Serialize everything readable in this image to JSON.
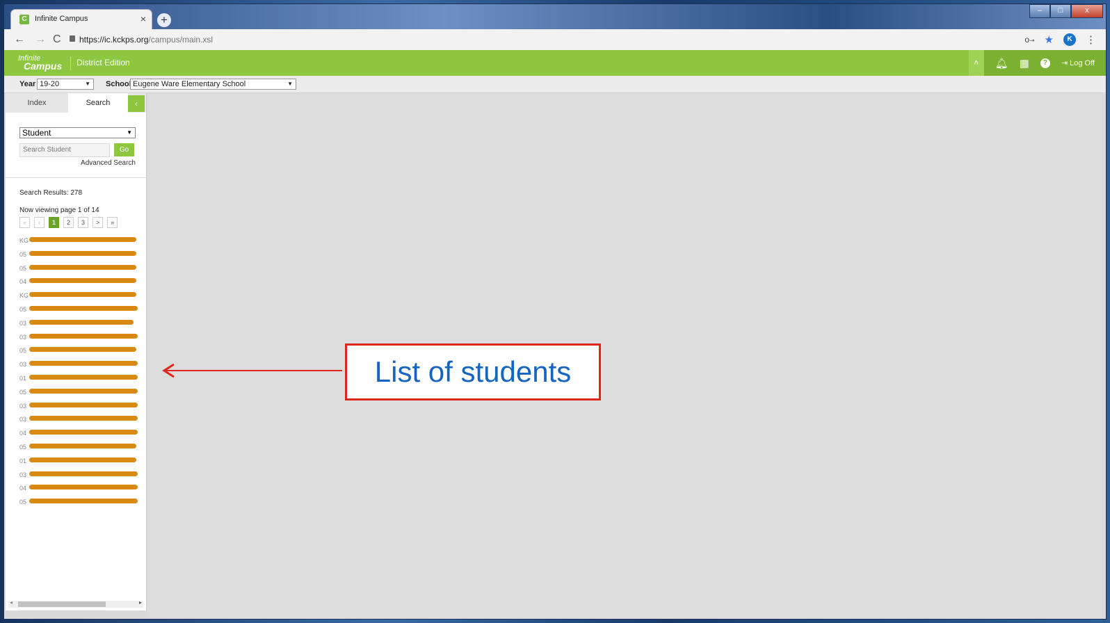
{
  "browser": {
    "tab_title": "Infinite Campus",
    "tab_close": "×",
    "new_tab": "+",
    "url_host": "https://ic.kckps.org",
    "url_path": "/campus/main.xsl",
    "avatar_letter": "K"
  },
  "app": {
    "logo_line1": "Infinite",
    "logo_line2": "Campus",
    "edition": "District Edition",
    "logoff_label": "Log Off",
    "accent_color": "#8dc63f"
  },
  "context": {
    "year_label": "Year",
    "year_value": "19-20",
    "school_label": "School",
    "school_value": "Eugene Ware Elementary School"
  },
  "panel": {
    "tabs": [
      "Index",
      "Search"
    ],
    "search_type": "Student",
    "search_placeholder": "Search Student",
    "go_label": "Go",
    "advanced_search": "Advanced Search",
    "results_text": "Search Results: 278",
    "viewing_text": "Now viewing page 1 of 14",
    "pager": [
      "«",
      "‹",
      "1",
      "2",
      "3",
      ">",
      "»"
    ],
    "students": [
      {
        "grade": "KG"
      },
      {
        "grade": "05"
      },
      {
        "grade": "05"
      },
      {
        "grade": "04"
      },
      {
        "grade": "KG"
      },
      {
        "grade": "05"
      },
      {
        "grade": "03"
      },
      {
        "grade": "03"
      },
      {
        "grade": "05"
      },
      {
        "grade": "03"
      },
      {
        "grade": "01"
      },
      {
        "grade": "05"
      },
      {
        "grade": "03"
      },
      {
        "grade": "03"
      },
      {
        "grade": "04"
      },
      {
        "grade": "05"
      },
      {
        "grade": "01"
      },
      {
        "grade": "03"
      },
      {
        "grade": "04"
      },
      {
        "grade": "05"
      }
    ]
  },
  "annotation": {
    "text": "List of students"
  }
}
